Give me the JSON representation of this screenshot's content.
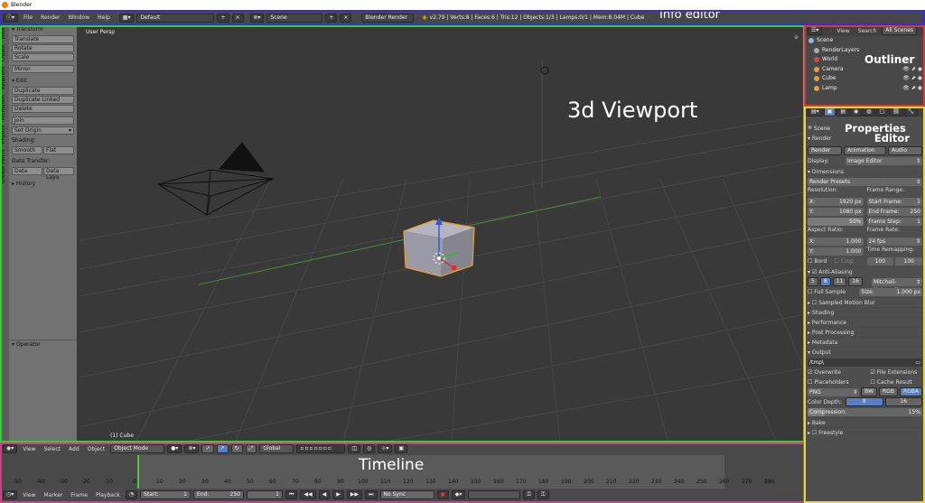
{
  "window": {
    "title": "Blender"
  },
  "info": {
    "menus": [
      "File",
      "Render",
      "Window",
      "Help"
    ],
    "layout": "Default",
    "scene": "Scene",
    "engine": "Blender Render",
    "stats": "v2.79 | Verts:8 | Faces:6 | Tris:12 | Objects:1/3 | Lamps:0/1 | Mem:8.04M | Cube",
    "tag": "Info editor"
  },
  "viewport": {
    "view_name": "User Persp",
    "object_label": "(1) Cube",
    "tag": "3d Viewport",
    "tabs": [
      "Tools",
      "Create",
      "Relations",
      "Animation",
      "Physics",
      "Grease Pencil"
    ]
  },
  "toolshelf": {
    "transform_title": "Transform",
    "transform_buttons": [
      "Translate",
      "Rotate",
      "Scale"
    ],
    "mirror": "Mirror",
    "edit_title": "Edit",
    "edit_buttons": [
      "Duplicate",
      "Duplicate Linked",
      "Delete"
    ],
    "join": "Join",
    "set_origin": "Set Origin",
    "shading_label": "Shading:",
    "smooth": "Smooth",
    "flat": "Flat",
    "data_transfer_label": "Data Transfer:",
    "data": "Data",
    "data_layout": "Data Layo",
    "history": "History",
    "operator": "Operator"
  },
  "vp_header": {
    "menus": [
      "View",
      "Select",
      "Add",
      "Object"
    ],
    "mode": "Object Mode",
    "orientation": "Global"
  },
  "outliner": {
    "menus": [
      "View",
      "Search"
    ],
    "filter": "All Scenes",
    "tag": "Outliner",
    "items": [
      {
        "name": "Scene",
        "color": "#8fb6e0"
      },
      {
        "name": "RenderLayers",
        "color": "#aaaaaa"
      },
      {
        "name": "World",
        "color": "#c94a4a"
      },
      {
        "name": "Camera",
        "color": "#e0a040"
      },
      {
        "name": "Cube",
        "color": "#e0a040"
      },
      {
        "name": "Lamp",
        "color": "#e0a040"
      }
    ]
  },
  "properties": {
    "tag_line1": "Properties",
    "tag_line2": "Editor",
    "scene": "Scene",
    "render_title": "Render",
    "render_btn": "Render",
    "animation_btn": "Animation",
    "audio_btn": "Audio",
    "display_label": "Display:",
    "display_value": "Image Editor",
    "dimensions_title": "Dimensions",
    "render_presets": "Render Presets",
    "resolution_label": "Resolution:",
    "res_x_label": "X:",
    "res_x": "1920 px",
    "res_y_label": "Y:",
    "res_y": "1080 px",
    "res_pct": "50%",
    "frame_range_label": "Frame Range:",
    "start_label": "Start Frame:",
    "start": "1",
    "end_label": "End Frame:",
    "end": "250",
    "step_label": "Frame Step:",
    "step": "1",
    "aspect_label": "Aspect Ratio:",
    "asp_x": "1.000",
    "asp_y": "1.000",
    "frame_rate_label": "Frame Rate:",
    "frame_rate": "24 fps",
    "time_remap_label": "Time Remapping:",
    "remap_old": "100",
    "remap_new": "100",
    "bord": "Bord",
    "crop": "Crop",
    "aa_title": "Anti-Aliasing",
    "aa_samples": [
      "5",
      "8",
      "11",
      "16"
    ],
    "aa_filter": "Mitchell-Netravali",
    "full_sample": "Full Sample",
    "size_label": "Size:",
    "size": "1.000 px",
    "collapsed": [
      "Sampled Motion Blur",
      "Shading",
      "Performance",
      "Post Processing",
      "Metadata"
    ],
    "output_title": "Output",
    "output_path": "/tmp\\",
    "overwrite": "Overwrite",
    "file_ext": "File Extensions",
    "placeholders": "Placeholders",
    "cache_result": "Cache Result",
    "format": "PNG",
    "bw": "BW",
    "rgb": "RGB",
    "rgba": "RGBA",
    "color_depth_label": "Color Depth:",
    "depth_8": "8",
    "depth_16": "16",
    "compression_label": "Compression:",
    "compression": "15%",
    "bake": "Bake",
    "freestyle": "Freestyle"
  },
  "timeline": {
    "tag": "Timeline",
    "ticks": [
      "-50",
      "-40",
      "-30",
      "-20",
      "-10",
      "0",
      "10",
      "20",
      "30",
      "40",
      "50",
      "60",
      "70",
      "80",
      "90",
      "100",
      "110",
      "120",
      "130",
      "140",
      "150",
      "160",
      "170",
      "180",
      "190",
      "200",
      "210",
      "220",
      "230",
      "240",
      "250",
      "260",
      "270",
      "280"
    ],
    "menus": [
      "View",
      "Marker",
      "Frame",
      "Playback"
    ],
    "start": "Start:",
    "start_val": "1",
    "end": "End:",
    "end_val": "250",
    "current": "1",
    "sync": "No Sync"
  }
}
